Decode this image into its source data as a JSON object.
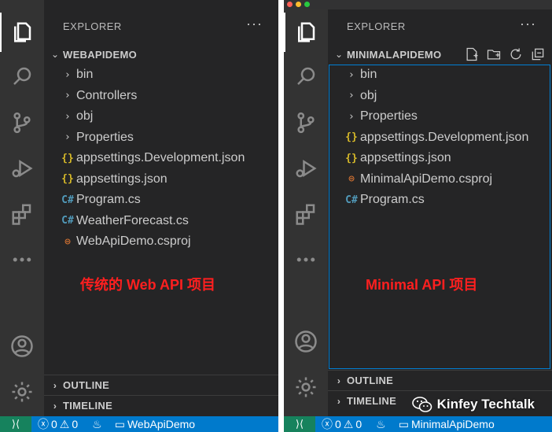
{
  "left": {
    "explorer_title": "EXPLORER",
    "more": "···",
    "root_name": "WEBAPIDEMO",
    "items": [
      {
        "icon": "folder-chevron",
        "glyph": "›",
        "label": "bin"
      },
      {
        "icon": "folder-chevron",
        "glyph": "›",
        "label": "Controllers"
      },
      {
        "icon": "folder-chevron",
        "glyph": "›",
        "label": "obj"
      },
      {
        "icon": "folder-chevron",
        "glyph": "›",
        "label": "Properties"
      },
      {
        "icon": "json-icon",
        "glyph": "{}",
        "label": "appsettings.Development.json"
      },
      {
        "icon": "json-icon",
        "glyph": "{}",
        "label": "appsettings.json"
      },
      {
        "icon": "csharp-icon",
        "glyph": "C#",
        "label": "Program.cs"
      },
      {
        "icon": "csharp-icon",
        "glyph": "C#",
        "label": "WeatherForecast.cs"
      },
      {
        "icon": "rss-icon",
        "glyph": "⊜",
        "label": "WebApiDemo.csproj"
      }
    ],
    "caption": "传统的 Web API 项目",
    "sections": [
      "OUTLINE",
      "TIMELINE"
    ],
    "status": {
      "errors": "0",
      "warnings": "0",
      "project": "WebApiDemo"
    }
  },
  "right": {
    "explorer_title": "EXPLORER",
    "more": "···",
    "root_name": "MINIMALAPIDEMO",
    "items": [
      {
        "icon": "folder-chevron",
        "glyph": "›",
        "label": "bin"
      },
      {
        "icon": "folder-chevron",
        "glyph": "›",
        "label": "obj"
      },
      {
        "icon": "folder-chevron",
        "glyph": "›",
        "label": "Properties"
      },
      {
        "icon": "json-icon",
        "glyph": "{}",
        "label": "appsettings.Development.json"
      },
      {
        "icon": "json-icon",
        "glyph": "{}",
        "label": "appsettings.json"
      },
      {
        "icon": "rss-icon",
        "glyph": "⊜",
        "label": "MinimalApiDemo.csproj"
      },
      {
        "icon": "csharp-icon",
        "glyph": "C#",
        "label": "Program.cs"
      }
    ],
    "caption": "Minimal  API 项目",
    "sections": [
      "OUTLINE",
      "TIMELINE"
    ],
    "status": {
      "errors": "0",
      "warnings": "0",
      "project": "MinimalApiDemo"
    },
    "watermark": "Kinfey Techtalk"
  },
  "colors": {
    "status_bar": "#007acc",
    "remote": "#16825d",
    "caption": "#ff1f1f",
    "focus": "#007fd4"
  }
}
